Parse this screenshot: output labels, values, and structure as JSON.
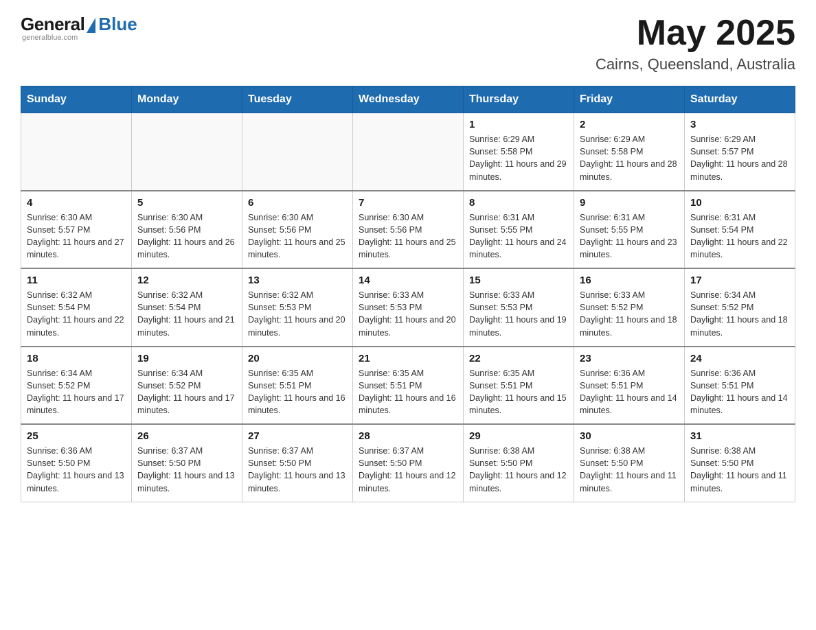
{
  "logo": {
    "general": "General",
    "blue": "Blue",
    "tagline": "generalblue.com"
  },
  "header": {
    "month": "May 2025",
    "location": "Cairns, Queensland, Australia"
  },
  "weekdays": [
    "Sunday",
    "Monday",
    "Tuesday",
    "Wednesday",
    "Thursday",
    "Friday",
    "Saturday"
  ],
  "weeks": [
    [
      {
        "day": "",
        "info": ""
      },
      {
        "day": "",
        "info": ""
      },
      {
        "day": "",
        "info": ""
      },
      {
        "day": "",
        "info": ""
      },
      {
        "day": "1",
        "info": "Sunrise: 6:29 AM\nSunset: 5:58 PM\nDaylight: 11 hours and 29 minutes."
      },
      {
        "day": "2",
        "info": "Sunrise: 6:29 AM\nSunset: 5:58 PM\nDaylight: 11 hours and 28 minutes."
      },
      {
        "day": "3",
        "info": "Sunrise: 6:29 AM\nSunset: 5:57 PM\nDaylight: 11 hours and 28 minutes."
      }
    ],
    [
      {
        "day": "4",
        "info": "Sunrise: 6:30 AM\nSunset: 5:57 PM\nDaylight: 11 hours and 27 minutes."
      },
      {
        "day": "5",
        "info": "Sunrise: 6:30 AM\nSunset: 5:56 PM\nDaylight: 11 hours and 26 minutes."
      },
      {
        "day": "6",
        "info": "Sunrise: 6:30 AM\nSunset: 5:56 PM\nDaylight: 11 hours and 25 minutes."
      },
      {
        "day": "7",
        "info": "Sunrise: 6:30 AM\nSunset: 5:56 PM\nDaylight: 11 hours and 25 minutes."
      },
      {
        "day": "8",
        "info": "Sunrise: 6:31 AM\nSunset: 5:55 PM\nDaylight: 11 hours and 24 minutes."
      },
      {
        "day": "9",
        "info": "Sunrise: 6:31 AM\nSunset: 5:55 PM\nDaylight: 11 hours and 23 minutes."
      },
      {
        "day": "10",
        "info": "Sunrise: 6:31 AM\nSunset: 5:54 PM\nDaylight: 11 hours and 22 minutes."
      }
    ],
    [
      {
        "day": "11",
        "info": "Sunrise: 6:32 AM\nSunset: 5:54 PM\nDaylight: 11 hours and 22 minutes."
      },
      {
        "day": "12",
        "info": "Sunrise: 6:32 AM\nSunset: 5:54 PM\nDaylight: 11 hours and 21 minutes."
      },
      {
        "day": "13",
        "info": "Sunrise: 6:32 AM\nSunset: 5:53 PM\nDaylight: 11 hours and 20 minutes."
      },
      {
        "day": "14",
        "info": "Sunrise: 6:33 AM\nSunset: 5:53 PM\nDaylight: 11 hours and 20 minutes."
      },
      {
        "day": "15",
        "info": "Sunrise: 6:33 AM\nSunset: 5:53 PM\nDaylight: 11 hours and 19 minutes."
      },
      {
        "day": "16",
        "info": "Sunrise: 6:33 AM\nSunset: 5:52 PM\nDaylight: 11 hours and 18 minutes."
      },
      {
        "day": "17",
        "info": "Sunrise: 6:34 AM\nSunset: 5:52 PM\nDaylight: 11 hours and 18 minutes."
      }
    ],
    [
      {
        "day": "18",
        "info": "Sunrise: 6:34 AM\nSunset: 5:52 PM\nDaylight: 11 hours and 17 minutes."
      },
      {
        "day": "19",
        "info": "Sunrise: 6:34 AM\nSunset: 5:52 PM\nDaylight: 11 hours and 17 minutes."
      },
      {
        "day": "20",
        "info": "Sunrise: 6:35 AM\nSunset: 5:51 PM\nDaylight: 11 hours and 16 minutes."
      },
      {
        "day": "21",
        "info": "Sunrise: 6:35 AM\nSunset: 5:51 PM\nDaylight: 11 hours and 16 minutes."
      },
      {
        "day": "22",
        "info": "Sunrise: 6:35 AM\nSunset: 5:51 PM\nDaylight: 11 hours and 15 minutes."
      },
      {
        "day": "23",
        "info": "Sunrise: 6:36 AM\nSunset: 5:51 PM\nDaylight: 11 hours and 14 minutes."
      },
      {
        "day": "24",
        "info": "Sunrise: 6:36 AM\nSunset: 5:51 PM\nDaylight: 11 hours and 14 minutes."
      }
    ],
    [
      {
        "day": "25",
        "info": "Sunrise: 6:36 AM\nSunset: 5:50 PM\nDaylight: 11 hours and 13 minutes."
      },
      {
        "day": "26",
        "info": "Sunrise: 6:37 AM\nSunset: 5:50 PM\nDaylight: 11 hours and 13 minutes."
      },
      {
        "day": "27",
        "info": "Sunrise: 6:37 AM\nSunset: 5:50 PM\nDaylight: 11 hours and 13 minutes."
      },
      {
        "day": "28",
        "info": "Sunrise: 6:37 AM\nSunset: 5:50 PM\nDaylight: 11 hours and 12 minutes."
      },
      {
        "day": "29",
        "info": "Sunrise: 6:38 AM\nSunset: 5:50 PM\nDaylight: 11 hours and 12 minutes."
      },
      {
        "day": "30",
        "info": "Sunrise: 6:38 AM\nSunset: 5:50 PM\nDaylight: 11 hours and 11 minutes."
      },
      {
        "day": "31",
        "info": "Sunrise: 6:38 AM\nSunset: 5:50 PM\nDaylight: 11 hours and 11 minutes."
      }
    ]
  ]
}
